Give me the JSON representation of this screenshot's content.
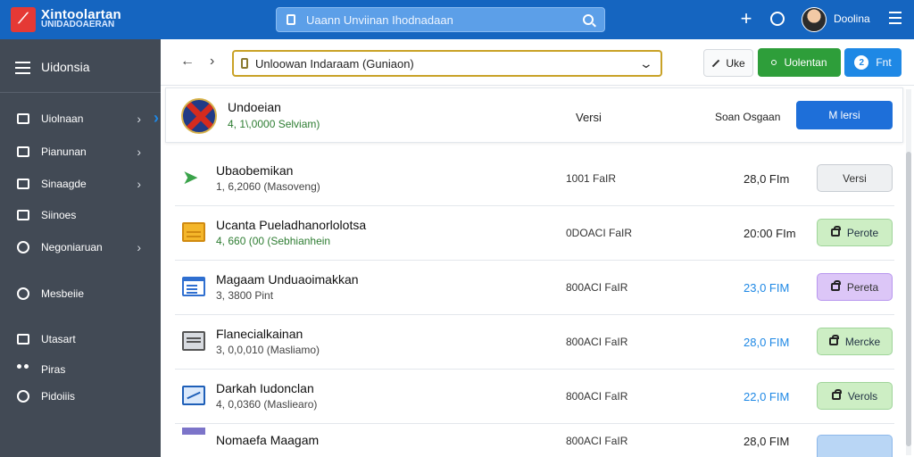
{
  "brand": {
    "title": "Xintoolartan",
    "subtitle": "UNIDADOAERAN"
  },
  "search": {
    "text": "Uaann Unviinan Ihodnadaan"
  },
  "user": {
    "name": "Doolina"
  },
  "sidebar": {
    "title": "Uidonsia",
    "items": [
      {
        "label": "Uiolnaan",
        "icon": "card-icon",
        "chevron": "›"
      },
      {
        "label": "Pianunan",
        "icon": "box-icon",
        "chevron": "›"
      },
      {
        "label": "Sinaagde",
        "icon": "storage-icon",
        "chevron": "›"
      },
      {
        "label": "Siinoes",
        "icon": "shop-icon",
        "chevron": ""
      },
      {
        "label": "Negoniaruan",
        "icon": "globe-icon",
        "chevron": "›"
      },
      {
        "label": "Mesbeiie",
        "icon": "chat-icon",
        "chevron": ""
      },
      {
        "label": "Utasart",
        "icon": "tag-icon",
        "chevron": ""
      },
      {
        "label": "Piras",
        "icon": "people-icon",
        "chevron": ""
      },
      {
        "label": "Pidoiiis",
        "icon": "info-icon",
        "chevron": ""
      }
    ]
  },
  "toolbar": {
    "back": "←",
    "forward": "›",
    "combo_value": "Unloowan Indaraam (Guniaon)",
    "combo_chevron": "⌄",
    "uke_label": "Uke",
    "green_label": "Uolentan",
    "blue_label": "Fnt",
    "blue_badge": "2"
  },
  "header_row": {
    "name": "Undoeian",
    "sub": "4, 1\\,0000 Selviam)",
    "version": "Versi",
    "sort": "Soan Osgaan",
    "button": "M lersi"
  },
  "rows": [
    {
      "name": "Ubaobemikan",
      "sub": "1, 6,2060 (Masoveng)",
      "size": "1001 FaIR",
      "price": "28,0 FIm",
      "action": "Versi",
      "icon": "arrow-icon"
    },
    {
      "name": "Ucanta Pueladhanorlolotsa",
      "sub": "4, 660 (00 (Sebhianhein",
      "size": "0DOACI FaIR",
      "price": "20:00 FIm",
      "action": "Perote",
      "icon": "folder-icon"
    },
    {
      "name": "Magaam Unduaoimakkan",
      "sub": "3, 3800 Pint",
      "size": "800ACI FaIR",
      "price": "23,0 FIM",
      "action": "Pereta",
      "icon": "document-icon"
    },
    {
      "name": "Flanecialkainan",
      "sub": "3, 0,0,010 (Masliamo)",
      "size": "800ACI FaIR",
      "price": "28,0 FIM",
      "action": "Mercke",
      "icon": "cash-icon"
    },
    {
      "name": "Darkah Iudonclan",
      "sub": "4, 0,0360 (Masliearo)",
      "size": "800ACI FaIR",
      "price": "22,0 FIM",
      "action": "Verols",
      "icon": "ticket-icon"
    },
    {
      "name": "Nomaefa Maagam",
      "sub": "",
      "size": "800ACI FaIR",
      "price": "28,0 FIM",
      "action": "",
      "icon": "doc-icon"
    }
  ]
}
